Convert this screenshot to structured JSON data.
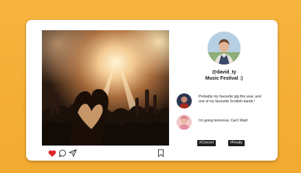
{
  "post": {
    "username": "@david_ty",
    "caption": "Music Festival :)",
    "comments": [
      {
        "text": "Probably my favourite gig this year, and one of my favourite Scottish bands !"
      },
      {
        "text": "I'm going tomorrow. Can't Wait!"
      }
    ],
    "tags": [
      "#Concert",
      "#Finally"
    ]
  },
  "actions": {
    "like_icon": "heart-icon",
    "comment_icon": "speech-bubble-icon",
    "share_icon": "paper-plane-icon",
    "save_icon": "bookmark-icon"
  },
  "colors": {
    "background": "#f5b23c",
    "card": "#ffffff",
    "like_active": "#e0242a",
    "tag_bg": "#1e1e1e"
  }
}
